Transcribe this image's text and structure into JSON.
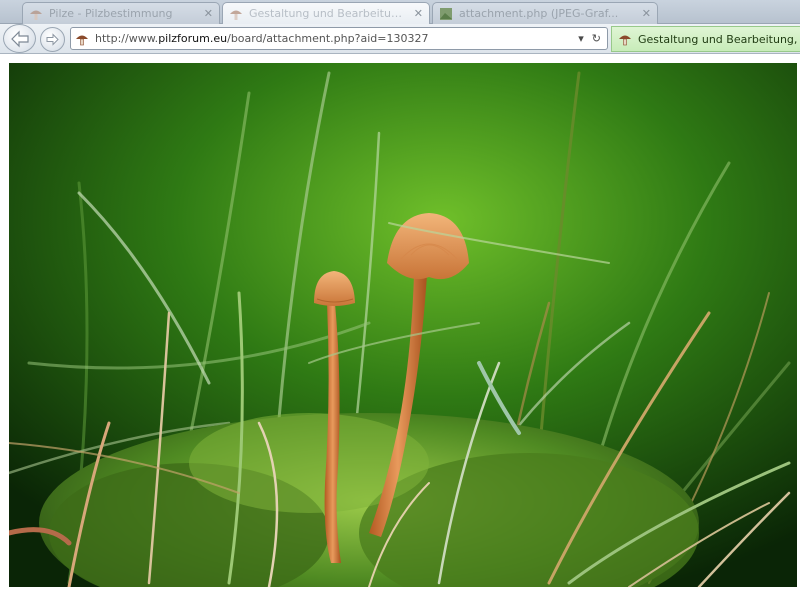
{
  "window": {
    "tabs": [
      {
        "label": "Pilze - Pilzbestimmung",
        "active": false
      },
      {
        "label": "Gestaltung und Bearbeitung...",
        "active": true
      },
      {
        "label": "attachment.php (JPEG-Graf...",
        "active": false
      }
    ]
  },
  "address_bar": {
    "url_prefix": "http://www.",
    "url_domain": "pilzforum.eu",
    "url_path": "/board/attachment.php?aid=130327",
    "dropdown_glyph": "▾",
    "refresh_glyph": "↻"
  },
  "active_tab_label": "Gestaltung und Bearbeitung, T...",
  "content": {
    "image_subject": "mushroom-photo"
  },
  "colors": {
    "favicon_cap": "#8b4a2b",
    "accent_tab": "#c8ecb9"
  }
}
